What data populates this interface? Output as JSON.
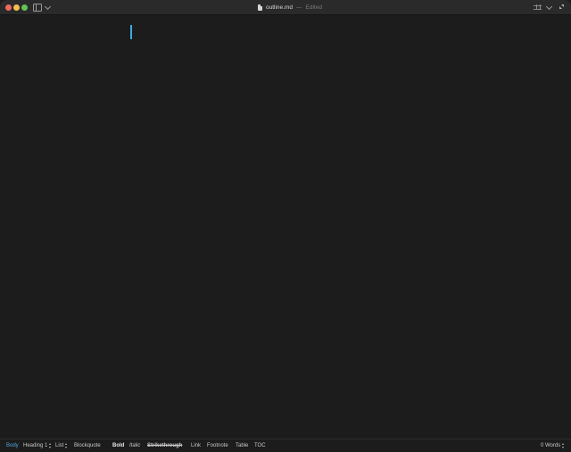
{
  "window": {
    "filename": "outline.md",
    "separator": "—",
    "status": "Edited"
  },
  "toolbar": {
    "body": "Body",
    "heading": "Heading 1",
    "list": "List",
    "blockquote": "Blockquote",
    "bold": "Bold",
    "italic": "Italic",
    "strikethrough": "Strikethrough",
    "link": "Link",
    "footnote": "Footnote",
    "table": "Table",
    "toc": "TOC",
    "word_count": "0 Words"
  },
  "colors": {
    "caret": "#3fa9e0",
    "active_style": "#4ea6dc",
    "background": "#1c1c1c"
  }
}
